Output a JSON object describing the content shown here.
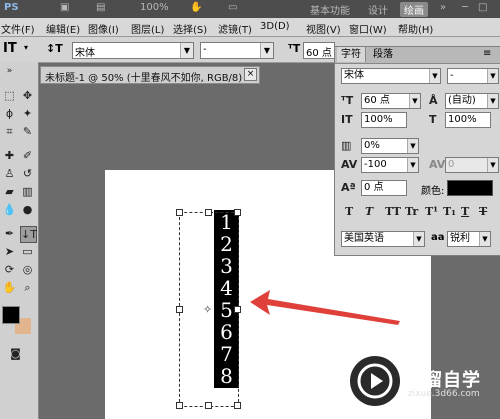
{
  "appbar": {
    "logo": "PS",
    "zoom": "100%",
    "workspace": "基本功能",
    "design": "设计",
    "painting": "绘画"
  },
  "menubar": {
    "items": [
      "文件(F)",
      "编辑(E)",
      "图像(I)",
      "图层(L)",
      "选择(S)",
      "滤镜(T)",
      "3D(D)",
      "视图(V)",
      "窗口(W)",
      "帮助(H)"
    ]
  },
  "options": {
    "font_family": "宋体",
    "font_style": "-",
    "font_size": "60 点"
  },
  "document": {
    "tab_label": "未标题-1 @ 50% (十里春风不如你, RGB/8) *",
    "close_label": "×",
    "digits": [
      "1",
      "2",
      "3",
      "4",
      "5",
      "6",
      "7",
      "8"
    ]
  },
  "char_panel": {
    "tab_char": "字符",
    "tab_para": "段落",
    "font_family": "宋体",
    "font_style": "-",
    "font_size": "60 点",
    "leading": "(自动)",
    "vertical_scale": "100%",
    "horizontal_scale": "100%",
    "kerning_ratio": "0%",
    "tracking": "-100",
    "kerning": "0",
    "baseline_shift": "0 点",
    "color_label": "颜色:",
    "color": "#000000",
    "language": "美国英语",
    "aa_prefix": "aa",
    "antialias": "锐利",
    "style_buttons": [
      "T",
      "T",
      "TT",
      "Tr",
      "T¹",
      "T₁",
      "T",
      "T"
    ]
  },
  "toolbox": {
    "fg_color": "#000000",
    "bg_color": "#e3b58f"
  },
  "arrow_color": "#e0403a",
  "logo": {
    "title": "溜溜自学",
    "url": "zixue.3d66.com"
  }
}
